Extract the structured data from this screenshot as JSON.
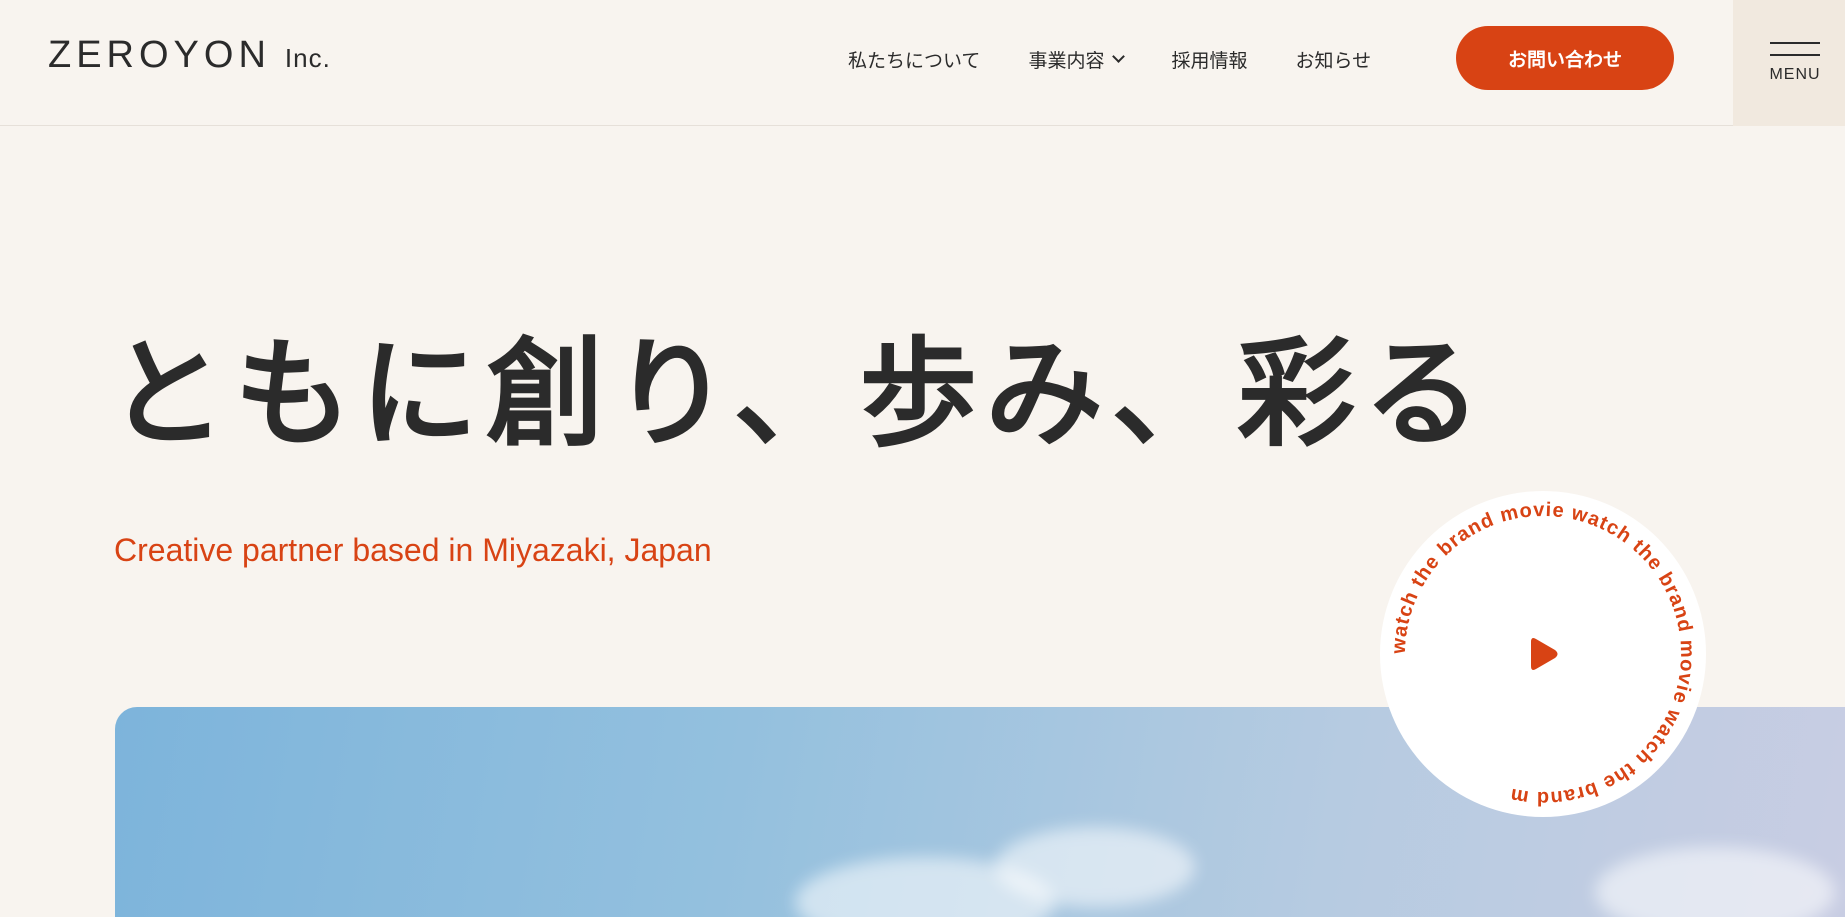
{
  "header": {
    "logo_main": "ZEROYON",
    "logo_suffix": "Inc.",
    "nav": {
      "about": "私たちについて",
      "business": "事業内容",
      "recruit": "採用情報",
      "news": "お知らせ"
    },
    "contact_label": "お問い合わせ",
    "menu_label": "MENU"
  },
  "hero": {
    "title": "ともに創り、歩み、彩る",
    "subtitle": "Creative partner based in Miyazaki, Japan"
  },
  "movie_badge": {
    "circular_text": "watch the brand movie watch the brand movie watch the brand m",
    "icon": "play-icon"
  },
  "colors": {
    "accent": "#d84314",
    "background": "#f8f4ef",
    "text": "#2b2b2b"
  }
}
